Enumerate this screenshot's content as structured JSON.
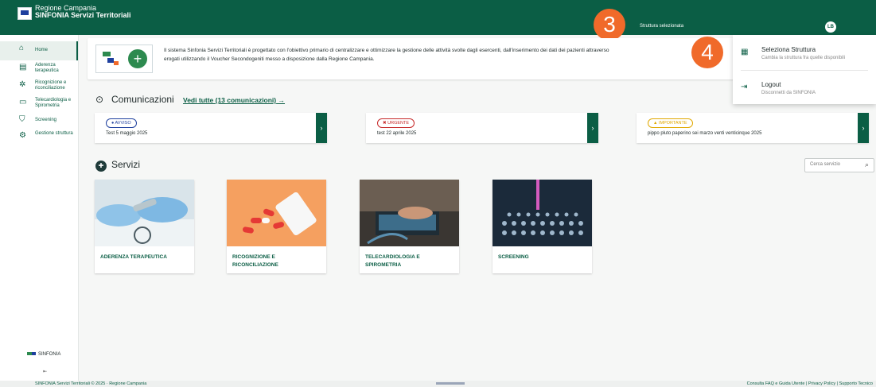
{
  "colors": {
    "primary": "#0b5e45",
    "accent": "#f06a2a",
    "avviso": "#1e3f9e",
    "urgente": "#c62828",
    "importante": "#e0a800"
  },
  "header": {
    "org": "Regione Campania",
    "app": "SINFONIA Servizi Territoriali",
    "struttura_label": "Struttura selezionata",
    "avatar_initials": "LB"
  },
  "step_badges": [
    "3",
    "4"
  ],
  "sidebar": {
    "items": [
      {
        "label": "Home",
        "icon": "home-icon"
      },
      {
        "label": "Aderenza terapeutica",
        "icon": "pill-icon"
      },
      {
        "label": "Ricognizione e riconciliazione",
        "icon": "capsules-icon"
      },
      {
        "label": "Telecardiologia e Spirometria",
        "icon": "monitor-heart-icon"
      },
      {
        "label": "Screening",
        "icon": "shield-icon"
      },
      {
        "label": "Gestione struttura",
        "icon": "gears-icon"
      }
    ],
    "logo_text": "SINFONIA",
    "collapse_label": "⇤"
  },
  "intro": {
    "text_line1": "Il sistema Sinfonia Servizi Territoriali è progettato con l'obiettivo primario di centralizzare e ottimizzare la gestione delle attività svolte dagli esercenti, dall'inserimento dei dati dei pazienti attraverso",
    "text_line2": "erogati utilizzando il Voucher Secondogeniti messo a disposizione dalla Regione Campania."
  },
  "comunicazioni": {
    "title": "Comunicazioni",
    "link": "Vedi tutte (13 comunicazioni)",
    "cards": [
      {
        "tag": "AVVISO",
        "text": "Test 5 maggio 2025"
      },
      {
        "tag": "URGENTE",
        "text": "test 22 aprile 2025"
      },
      {
        "tag": "IMPORTANTE",
        "text": "pippo pluto paperino sei marzo venti venticinque 2025"
      }
    ]
  },
  "servizi": {
    "title": "Servizi",
    "search_placeholder": "Cerca servizio",
    "cards": [
      {
        "label": "ADERENZA TERAPEUTICA"
      },
      {
        "label": "RICOGNIZIONE E RICONCILIAZIONE"
      },
      {
        "label": "TELECARDIOLOGIA E SPIROMETRIA"
      },
      {
        "label": "SCREENING"
      }
    ]
  },
  "dropdown": {
    "select_title": "Seleziona Struttura",
    "select_sub": "Cambia la struttura fra quelle disponibili",
    "logout_title": "Logout",
    "logout_sub": "Disconnetti da SINFONIA"
  },
  "footer": {
    "left": "SINFONIA Servizi Territoriali © 2025 · Regione Campania",
    "right": "Consulta FAQ e Guida Utente | Privacy Policy | Supporto Tecnico"
  }
}
